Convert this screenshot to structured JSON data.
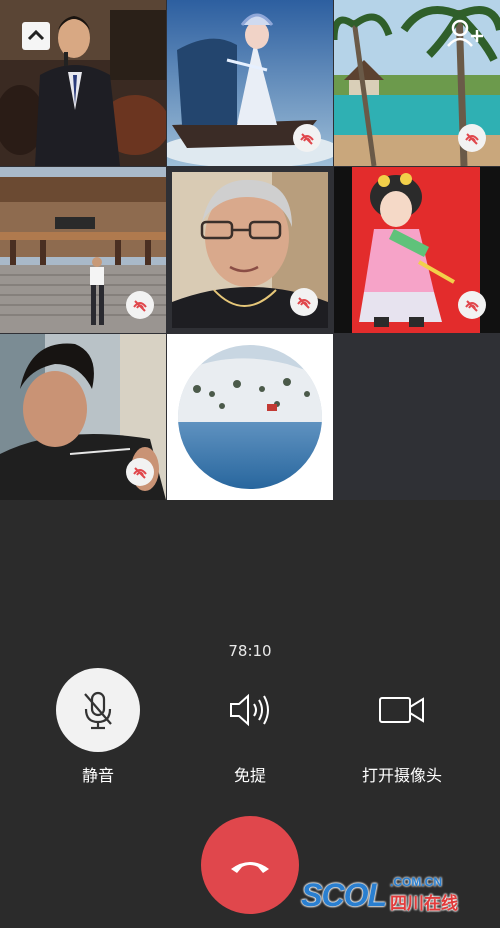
{
  "call": {
    "timer": "78:10",
    "controls": [
      {
        "label": "静音",
        "icon": "microphone-muted-icon",
        "active": true
      },
      {
        "label": "免提",
        "icon": "speaker-icon",
        "active": false
      },
      {
        "label": "打开摄像头",
        "icon": "camera-icon",
        "active": false
      }
    ],
    "hangup_icon": "hang-up-phone-icon"
  },
  "participants": [
    {
      "id": "singer",
      "muted": false
    },
    {
      "id": "opera-boat",
      "muted": true
    },
    {
      "id": "resort-pool",
      "muted": true
    },
    {
      "id": "temple-visitor",
      "muted": true
    },
    {
      "id": "elder-woman",
      "muted": true
    },
    {
      "id": "cartoon-opera",
      "muted": true
    },
    {
      "id": "young-man",
      "muted": true
    },
    {
      "id": "snow-lake",
      "muted": false
    }
  ],
  "watermark": {
    "logo": "SCOL",
    "domain": ".COM.CN",
    "cn": "四川在线"
  },
  "colors": {
    "hangup": "#e0474c",
    "background": "#2b2b2b",
    "active_control": "#f2f2f2"
  }
}
